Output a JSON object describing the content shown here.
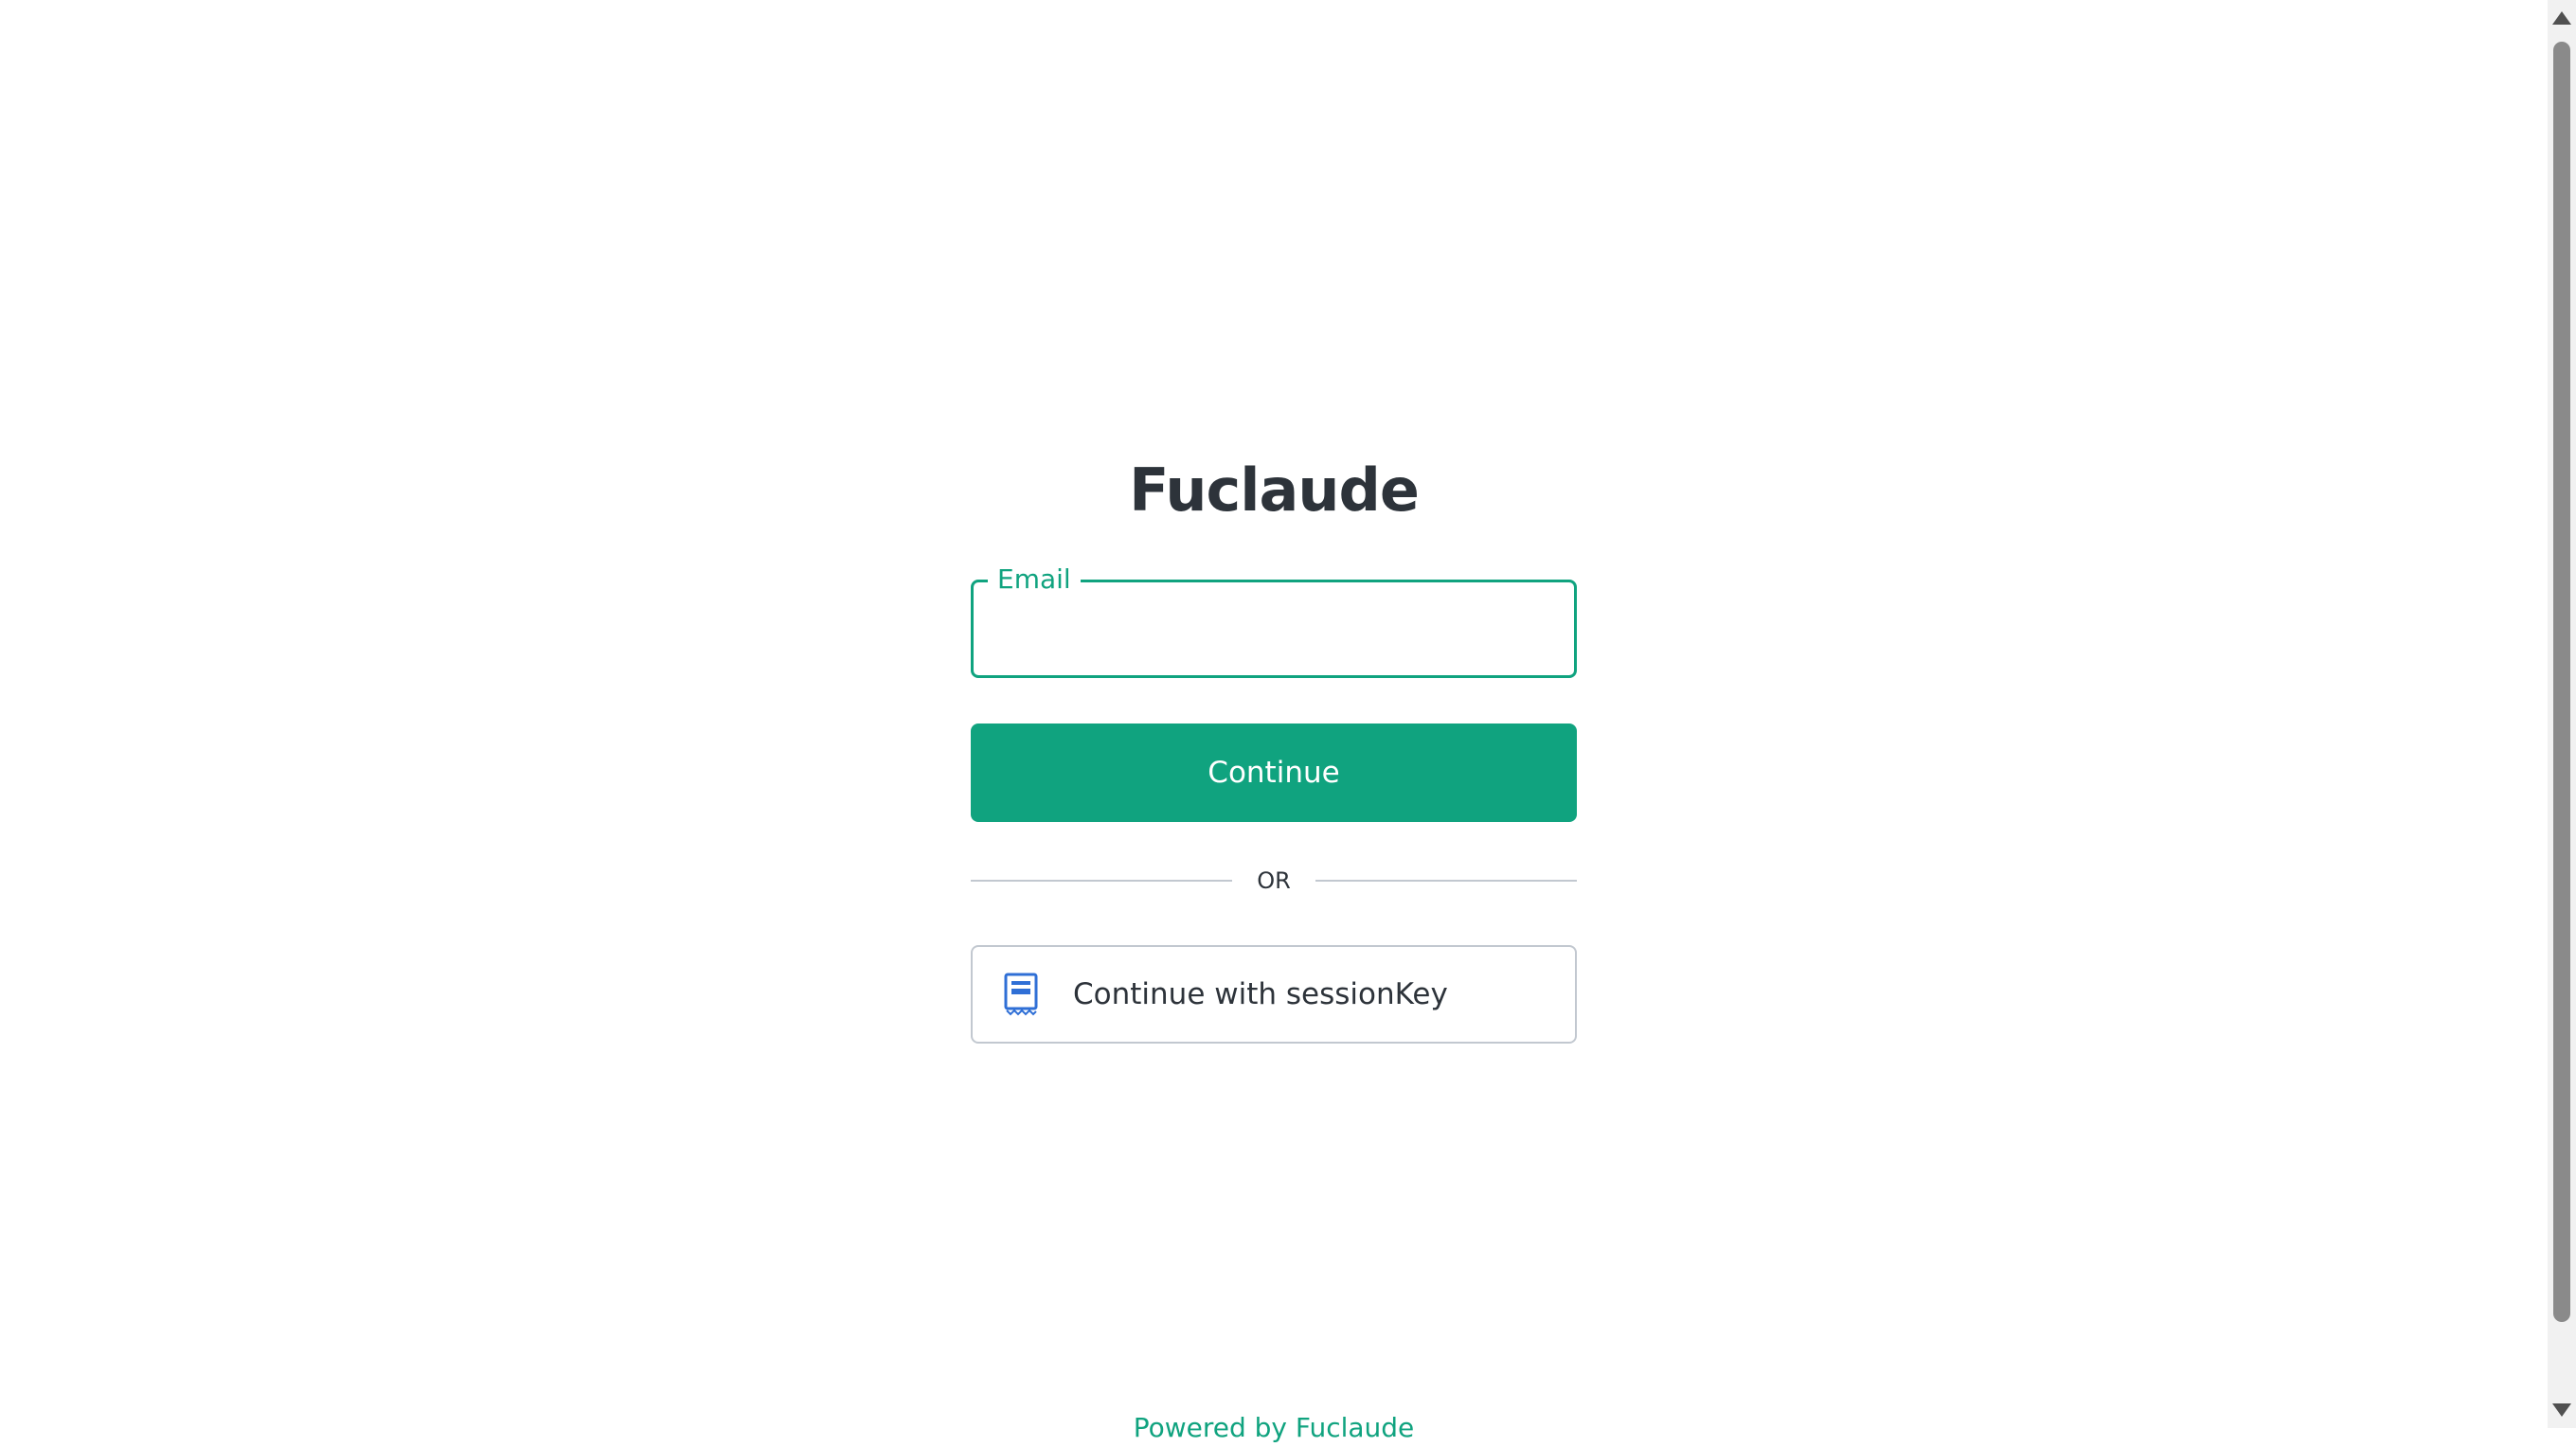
{
  "app": {
    "title": "Fuclaude"
  },
  "login": {
    "email_label": "Email",
    "email_value": "",
    "continue_label": "Continue",
    "divider_text": "OR",
    "session_button_label": "Continue with sessionKey",
    "session_icon": "document-icon"
  },
  "footer": {
    "powered_by": "Powered by Fuclaude"
  },
  "colors": {
    "accent": "#10a37f",
    "text": "#2d333a",
    "border": "#c2c8d0",
    "icon": "#2f6fd6"
  }
}
